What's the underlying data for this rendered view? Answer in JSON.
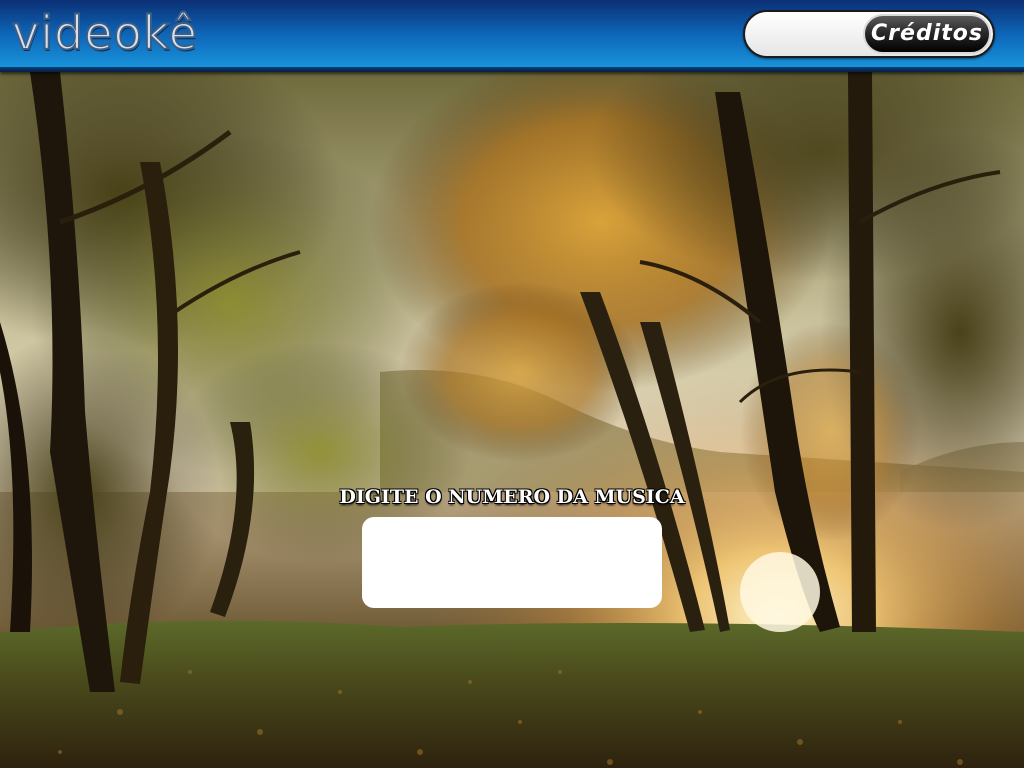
{
  "header": {
    "logo_text": "videokê",
    "credits_value": "",
    "credits_button_label": "Créditos"
  },
  "main": {
    "prompt_label": "DIGITE O NUMERO DA MUSICA",
    "song_number_value": ""
  },
  "colors": {
    "header_blue": "#0d63b5",
    "input_background": "#ffffff"
  }
}
